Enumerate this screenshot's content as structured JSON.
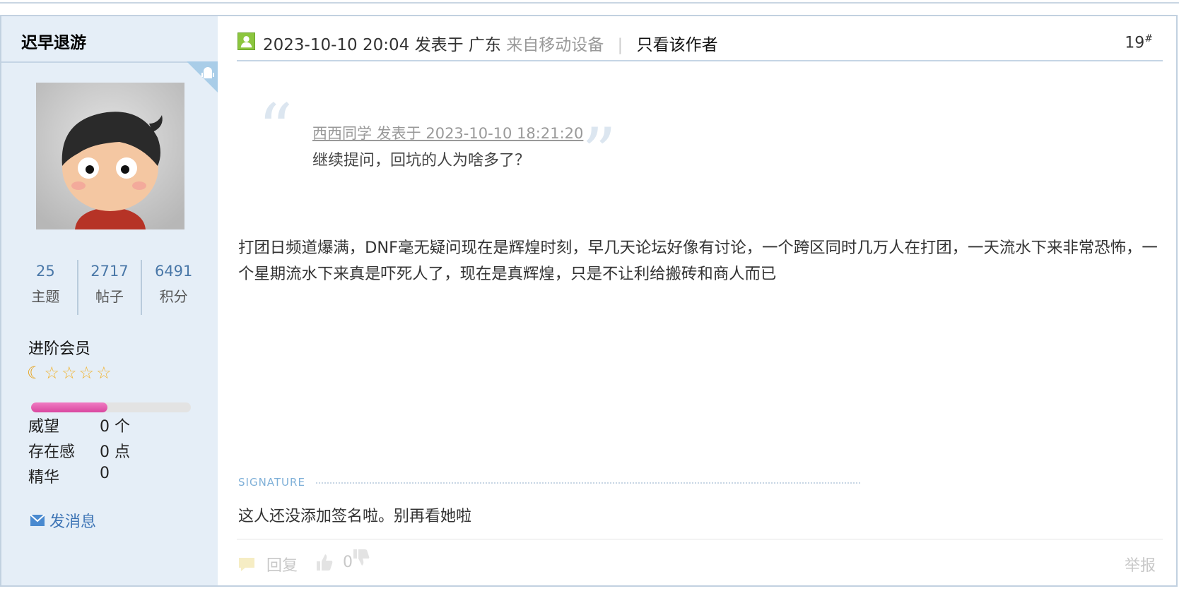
{
  "post": {
    "username": "迟早退游",
    "stats": [
      {
        "value": "25",
        "label": "主题"
      },
      {
        "value": "2717",
        "label": "帖子"
      },
      {
        "value": "6491",
        "label": "积分"
      }
    ],
    "group": "进阶会员",
    "level_progress": 0.48,
    "info": [
      {
        "label": "威望",
        "value": "0 个"
      },
      {
        "label": "存在感",
        "value": "0 点"
      },
      {
        "label": "精华",
        "value": "0"
      }
    ],
    "send_message": "发消息",
    "header": {
      "datetime": "2023-10-10 20:04",
      "posted_in": "发表于",
      "location": "广东",
      "device": "来自移动设备",
      "separator": "|",
      "only_author": "只看该作者",
      "floor": "19",
      "floor_mark": "#"
    },
    "quote": {
      "meta": "西西同学 发表于 2023-10-10 18:21:20",
      "text": "继续提问，回坑的人为啥多了？"
    },
    "body": "打团日频道爆满，DNF毫无疑问现在是辉煌时刻，早几天论坛好像有讨论，一个跨区同时几万人在打团，一天流水下来非常恐怖，一个星期流水下来真是吓死人了，现在是真辉煌，只是不让利给搬砖和商人而已",
    "signature_label": "SIGNATURE",
    "signature": "这人还没添加签名啦。别再看她啦",
    "footer": {
      "reply": "回复",
      "likes": "0",
      "report": "举报"
    },
    "colors": {
      "sidebar_bg": "#e5eef7",
      "accent_blue": "#3d74b5",
      "progress": "#d9479f"
    }
  }
}
